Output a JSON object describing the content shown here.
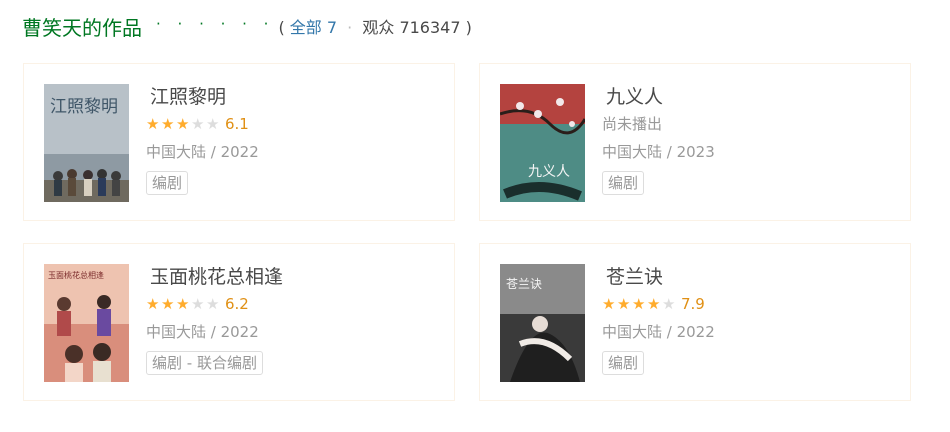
{
  "header": {
    "title": "曹笑天的作品",
    "dots": "· · · · · ·",
    "open_paren": "(",
    "all_label": "全部 7",
    "separator": "·",
    "audience": "观众 716347",
    "close_paren": ")"
  },
  "works": [
    {
      "name": "江照黎明",
      "rating": 6.1,
      "score": "6.1",
      "stars": 3,
      "region_year": "中国大陆 / 2022",
      "role": "编剧",
      "poster_text": "江照黎明",
      "colors": {
        "poster_bg": "#a9b3bb"
      }
    },
    {
      "name": "九义人",
      "status": "尚未播出",
      "region_year": "中国大陆 / 2023",
      "role": "编剧",
      "poster_text": "九义人",
      "colors": {
        "poster_bg": "#4e8c85"
      }
    },
    {
      "name": "玉面桃花总相逢",
      "rating": 6.2,
      "score": "6.2",
      "stars": 3,
      "region_year": "中国大陆 / 2022",
      "role": "编剧 - 联合编剧",
      "poster_text": "玉面桃花总相逢",
      "colors": {
        "poster_bg": "#e9b8a6"
      }
    },
    {
      "name": "苍兰诀",
      "rating": 7.9,
      "score": "7.9",
      "stars": 4,
      "region_year": "中国大陆 / 2022",
      "role": "编剧",
      "poster_text": "苍兰诀",
      "colors": {
        "poster_bg": "#3c3c3c"
      }
    }
  ],
  "colors": {
    "title_green": "#007722",
    "link_blue": "#3377aa",
    "star_orange": "#ffac2d",
    "score_orange": "#e09015",
    "card_border": "#fbf2e6"
  }
}
